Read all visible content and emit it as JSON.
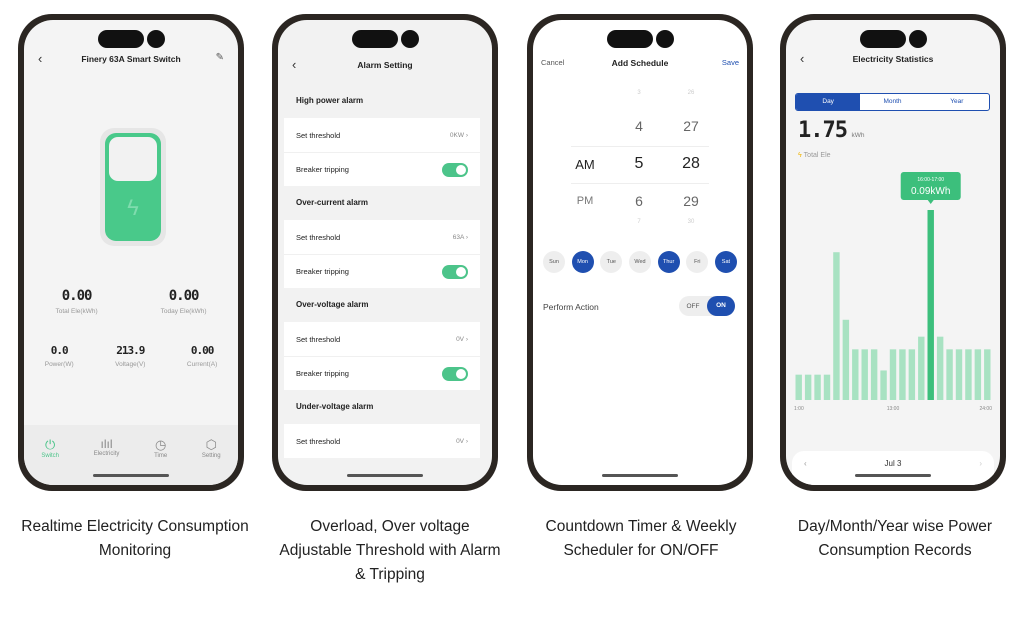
{
  "screen1": {
    "title": "Finery 63A Smart Switch",
    "stats": [
      {
        "value": "0.00",
        "label": "Total Ele(kWh)"
      },
      {
        "value": "0.00",
        "label": "Today Ele(kWh)"
      }
    ],
    "metrics": [
      {
        "value": "0.0",
        "label": "Power(W)"
      },
      {
        "value": "213.9",
        "label": "Voltage(V)"
      },
      {
        "value": "0.00",
        "label": "Current(A)"
      }
    ],
    "nav": [
      {
        "label": "Switch",
        "icon": "power-icon",
        "active": true
      },
      {
        "label": "Electricity",
        "icon": "bar-chart-icon"
      },
      {
        "label": "Time",
        "icon": "clock-icon"
      },
      {
        "label": "Setting",
        "icon": "gear-icon"
      }
    ],
    "accent": "#4cc48a"
  },
  "screen2": {
    "title": "Alarm Setting",
    "sections": [
      {
        "title": "High power alarm",
        "threshold_label": "Set threshold",
        "threshold": "0KW",
        "tripping_label": "Breaker tripping",
        "tripping": true
      },
      {
        "title": "Over-current alarm",
        "threshold_label": "Set threshold",
        "threshold": "63A",
        "tripping_label": "Breaker tripping",
        "tripping": true
      },
      {
        "title": "Over-voltage alarm",
        "threshold_label": "Set threshold",
        "threshold": "0V",
        "tripping_label": "Breaker tripping",
        "tripping": true
      },
      {
        "title": "Under-voltage alarm",
        "threshold_label": "Set threshold",
        "threshold": "0V"
      }
    ]
  },
  "screen3": {
    "cancel": "Cancel",
    "title": "Add Schedule",
    "save": "Save",
    "ampm": [
      "AM",
      "PM"
    ],
    "hours": [
      "3",
      "4",
      "5",
      "6",
      "7"
    ],
    "minutes": [
      "26",
      "27",
      "28",
      "29",
      "30"
    ],
    "days": [
      {
        "label": "Sun",
        "on": false
      },
      {
        "label": "Mon",
        "on": true
      },
      {
        "label": "Tue",
        "on": false
      },
      {
        "label": "Wed",
        "on": false
      },
      {
        "label": "Thur",
        "on": true
      },
      {
        "label": "Fri",
        "on": false
      },
      {
        "label": "Sat",
        "on": true
      }
    ],
    "action_label": "Perform Action",
    "off": "OFF",
    "on": "ON",
    "accent": "#1f4fb0"
  },
  "screen4": {
    "title": "Electricity Statistics",
    "tabs": [
      "Day",
      "Month",
      "Year"
    ],
    "active_tab": "Day",
    "total": "1.75",
    "unit": "kWh",
    "total_label": "Total Ele",
    "tooltip_time": "16:00-17:00",
    "tooltip_value": "0.09kWh",
    "date": "Jul 3",
    "prev": "‹",
    "next": "›"
  },
  "chart_data": {
    "type": "bar",
    "x_tick_labels": [
      "1:00",
      "13:00",
      "24:00"
    ],
    "values": [
      0.012,
      0.012,
      0.012,
      0.012,
      0.07,
      0.038,
      0.024,
      0.024,
      0.024,
      0.014,
      0.024,
      0.024,
      0.024,
      0.03,
      0.09,
      0.03,
      0.024,
      0.024,
      0.024,
      0.024,
      0.024
    ],
    "highlight_index": 14,
    "unit": "kWh",
    "bar_color": "#a8e2c2",
    "highlight_color": "#3cbf7c"
  },
  "captions": [
    "Realtime Electricity Consumption Monitoring",
    "Overload, Over voltage Adjustable Threshold with Alarm & Tripping",
    "Countdown Timer & Weekly Scheduler for ON/OFF",
    "Day/Month/Year wise Power Consumption Records"
  ]
}
